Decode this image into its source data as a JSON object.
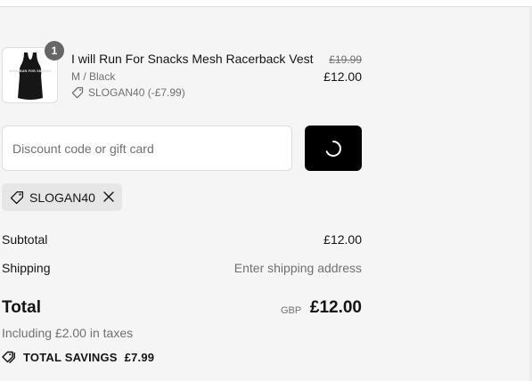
{
  "colors": {
    "background": "#f5f5f5",
    "primary_button": "#000000",
    "muted_text": "#707070",
    "badge": "#666666",
    "tag_background": "#e6e6e6"
  },
  "line_item": {
    "quantity": "1",
    "name": "I will Run For Snacks Mesh Racerback Vest",
    "variant": "M / Black",
    "discount_label": "SLOGAN40 (-£7.99)",
    "original_price": "£19.99",
    "price": "£12.00",
    "thumbnail_icon": "black-racerback-vest-image",
    "thumbnail_print": "WILL RUN FOR SNACKS"
  },
  "discount": {
    "placeholder": "Discount code or gift card",
    "value": "",
    "apply_button_state": "loading-spinner"
  },
  "applied_code": {
    "code": "SLOGAN40",
    "tag_icon": "tag-icon",
    "remove_icon": "close-icon"
  },
  "summary": {
    "subtotal_label": "Subtotal",
    "subtotal_value": "£12.00",
    "shipping_label": "Shipping",
    "shipping_value": "Enter shipping address",
    "total_label": "Total",
    "currency": "GBP",
    "total_value": "£12.00",
    "taxes_note": "Including £2.00 in taxes",
    "savings_label": "TOTAL SAVINGS",
    "savings_value": "£7.99",
    "savings_icon": "tags-icon"
  }
}
